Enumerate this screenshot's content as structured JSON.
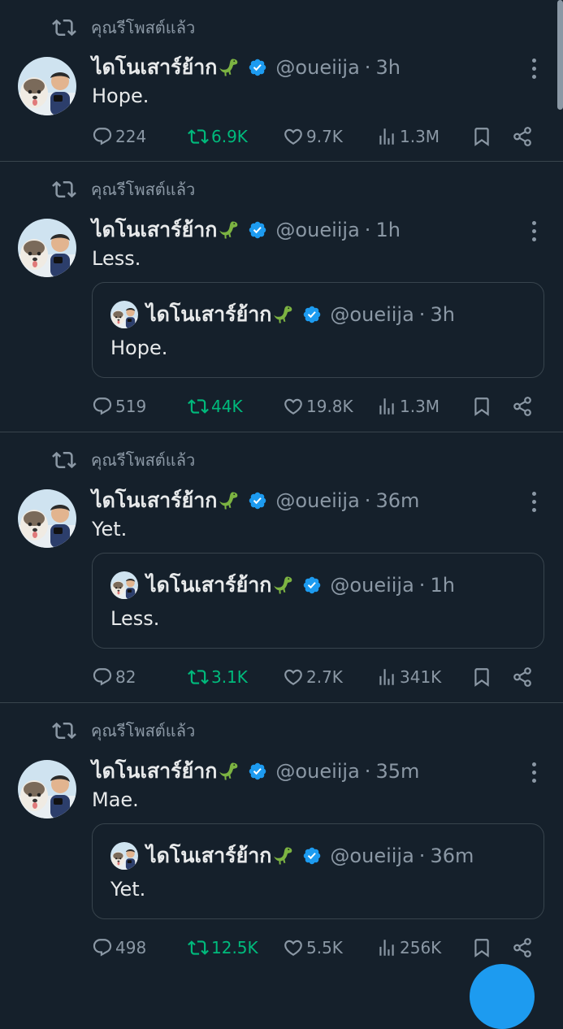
{
  "retweet_label": "คุณรีโพสต์แล้ว",
  "author": {
    "name": "ไดโนเสาร์ย้าก",
    "name_emoji": "dinosaur",
    "handle": "@oueiija",
    "verified": true
  },
  "colors": {
    "background": "#15202b",
    "text": "#e7e9ea",
    "muted": "#8b98a5",
    "repost_green": "#00ba7c",
    "verified_blue": "#1d9bf0",
    "border": "#38444d"
  },
  "icons": [
    "repost-icon",
    "reply-icon",
    "like-icon",
    "views-icon",
    "bookmark-icon",
    "share-icon",
    "more-icon",
    "verified-badge-icon",
    "dinosaur-emoji-icon"
  ],
  "tweets": [
    {
      "time": "3h",
      "text": "Hope.",
      "stats": {
        "replies": "224",
        "reposts": "6.9K",
        "likes": "9.7K",
        "views": "1.3M"
      }
    },
    {
      "time": "1h",
      "text": "Less.",
      "quote": {
        "time": "3h",
        "text": "Hope."
      },
      "stats": {
        "replies": "519",
        "reposts": "44K",
        "likes": "19.8K",
        "views": "1.3M"
      }
    },
    {
      "time": "36m",
      "text": "Yet.",
      "quote": {
        "time": "1h",
        "text": "Less."
      },
      "stats": {
        "replies": "82",
        "reposts": "3.1K",
        "likes": "2.7K",
        "views": "341K"
      }
    },
    {
      "time": "35m",
      "text": "Mae.",
      "quote": {
        "time": "36m",
        "text": "Yet."
      },
      "stats": {
        "replies": "498",
        "reposts": "12.5K",
        "likes": "5.5K",
        "views": "256K"
      }
    }
  ]
}
